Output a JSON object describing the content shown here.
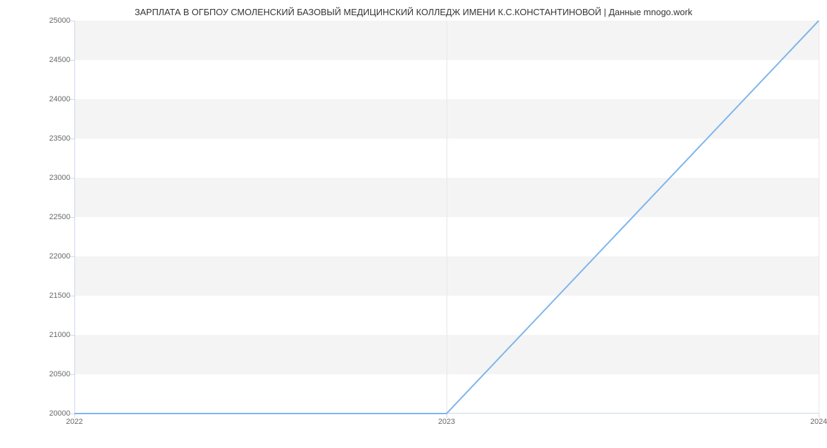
{
  "chart_data": {
    "type": "line",
    "title": "ЗАРПЛАТА В ОГБПОУ СМОЛЕНСКИЙ БАЗОВЫЙ МЕДИЦИНСКИЙ КОЛЛЕДЖ ИМЕНИ К.С.КОНСТАНТИНОВОЙ | Данные mnogo.work",
    "x": [
      2022,
      2023,
      2024
    ],
    "categories": [
      "2022",
      "2023",
      "2024"
    ],
    "values": [
      20000,
      20000,
      25000
    ],
    "y_ticks": [
      20000,
      20500,
      21000,
      21500,
      22000,
      22500,
      23000,
      23500,
      24000,
      24500,
      25000
    ],
    "y_tick_labels": [
      "20000",
      "20500",
      "21000",
      "21500",
      "22000",
      "22500",
      "23000",
      "23500",
      "24000",
      "24500",
      "25000"
    ],
    "xlabel": "",
    "ylabel": "",
    "ylim": [
      20000,
      25000
    ],
    "xlim": [
      2022,
      2024
    ],
    "line_color": "#7cb5ec"
  }
}
